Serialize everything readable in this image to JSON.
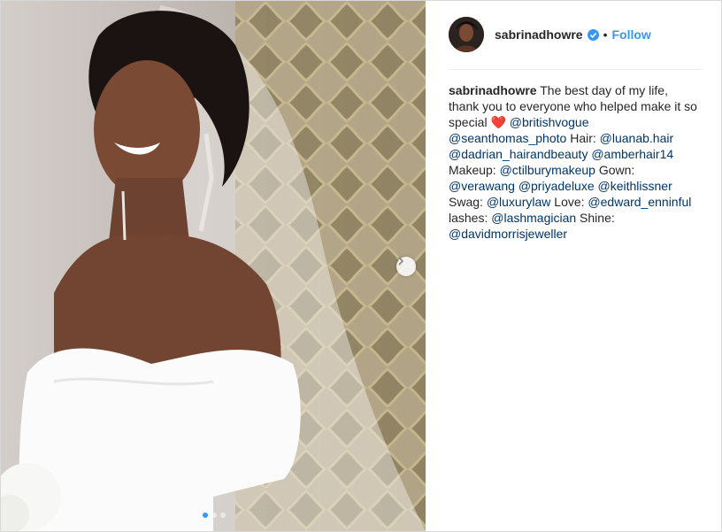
{
  "post": {
    "username": "sabrinadhowre",
    "separator": "•",
    "follow_label": "Follow",
    "verified_icon": "verified-badge-icon",
    "next_icon": "chevron-right-icon",
    "carousel": {
      "count": 3,
      "active_index": 0
    }
  },
  "caption": {
    "username": "sabrinadhowre",
    "intro": " The best day of my life, thank you to everyone who helped make it so special ",
    "heart": "❤️",
    "m1": "@britishvogue",
    "m2": "@seanthomas_photo",
    "t_hair": " Hair: ",
    "m3": "@luanab.hair",
    "m4": "@dadrian_hairandbeauty",
    "m5": "@amberhair14",
    "t_makeup": "Makeup: ",
    "m6": "@ctilburymakeup",
    "t_gown": " Gown: ",
    "m7": "@verawang",
    "m8": "@priyadeluxe",
    "m9": "@keithlissner",
    "t_swag": "Swag: ",
    "m10": "@luxurylaw",
    "t_love": " Love: ",
    "m11": "@edward_enninful",
    "t_lashes": "lashes: ",
    "m12": "@lashmagician",
    "t_shine": " Shine: ",
    "m13": "@davidmorrisjeweller"
  },
  "colors": {
    "link": "#003569",
    "follow": "#3897f0",
    "text": "#262626"
  }
}
